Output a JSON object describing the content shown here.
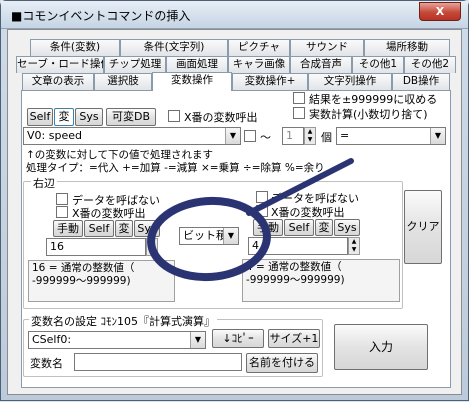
{
  "window": {
    "title": "■コモンイベントコマンドの挿入",
    "close_glyph": "X"
  },
  "tabs_row1": [
    "条件(変数)",
    "条件(文字列)",
    "ピクチャ",
    "サウンド",
    "場所移動"
  ],
  "tabs_row2": [
    "セーブ・ロード操作",
    "チップ処理",
    "画面処理",
    "キャラ画像",
    "合成音声",
    "その他1",
    "その他2"
  ],
  "tabs_row3": [
    "文章の表示",
    "選択肢",
    "変数操作",
    "変数操作+",
    "文字列操作",
    "DB操作"
  ],
  "checks_top": {
    "result_range": "結果を±999999に収める",
    "real_calc": "実数計算(小数切り捨て)"
  },
  "left_type_buttons": [
    "Self",
    "変",
    "Sys",
    "可変DB"
  ],
  "x_var_call": "X番の変数呼出",
  "target_var": "V0: speed",
  "tilde": "〜",
  "count_value": "1",
  "count_unit": "個",
  "assign_op": "=",
  "info_line1": "↑の変数に対して下の値で処理されます",
  "info_line2": "処理タイプ：=代入 +=加算 -=減算 ×=乗算 ÷=除算 %=余り",
  "right_side": {
    "legend": "右辺",
    "no_call": "データを呼ばない",
    "x_call": "X番の変数呼出",
    "buttons": [
      "手動",
      "Self",
      "変",
      "Sys"
    ],
    "left_value": "16",
    "right_value": "4",
    "left_desc_line1": "16 = 通常の整数値（",
    "left_desc_line2": "-999999〜999999)",
    "right_desc_line1": "4 = 通常の整数値（",
    "right_desc_line2": "-999999〜999999)",
    "operator": "ビット積"
  },
  "clear_label": "クリア",
  "varname": {
    "legend": "変数名の設定 ｺﾓﾝ105『計算式演算』",
    "selected": "CSelf0:",
    "copy_label": "↓ｺﾋﾟｰ",
    "size_label": "サイズ+1",
    "name_label": "変数名",
    "name_value": "",
    "apply_label": "名前を付ける"
  },
  "enter_label": "入力",
  "annotation_color": "#2b3473"
}
